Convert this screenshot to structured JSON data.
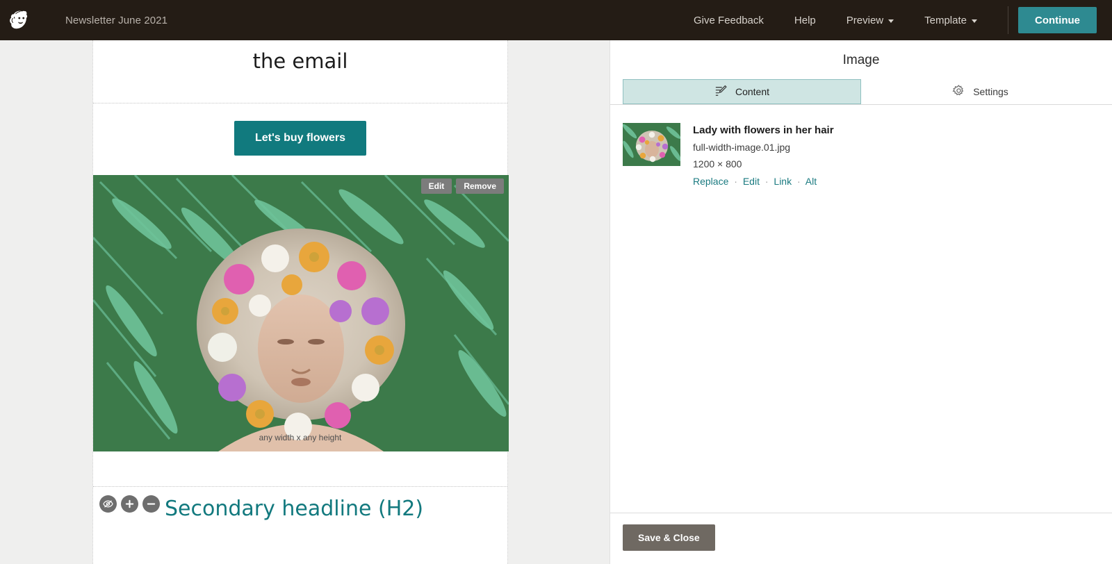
{
  "topbar": {
    "logo": "mailchimp-freddie-logo",
    "campaign_title": "Newsletter June 2021",
    "nav": [
      {
        "label": "Give Feedback",
        "caret": false
      },
      {
        "label": "Help",
        "caret": false
      },
      {
        "label": "Preview",
        "caret": true
      },
      {
        "label": "Template",
        "caret": true
      }
    ],
    "continue_label": "Continue",
    "bg_color": "#241c15",
    "accent_color": "#2e8a91"
  },
  "canvas": {
    "headline_partial": "the email",
    "cta_label": "Let's buy flowers",
    "cta_color": "#117a7e",
    "image_overlay": {
      "edit_label": "Edit",
      "remove_label": "Remove",
      "watermark": "any width x any height"
    },
    "h2_title": "Secondary headline (H2)",
    "h2_color": "#12797e",
    "tools": [
      {
        "name": "hide-eye-icon"
      },
      {
        "name": "plus-icon"
      },
      {
        "name": "minus-icon"
      }
    ]
  },
  "panel": {
    "title": "Image",
    "tabs": [
      {
        "label": "Content",
        "icon": "pencil-lines-icon",
        "active": true
      },
      {
        "label": "Settings",
        "icon": "gear-icon",
        "active": false
      }
    ],
    "media": {
      "name": "Lady with flowers in her hair",
      "filename": "full-width-image.01.jpg",
      "dimensions": "1200 × 800",
      "actions": [
        "Replace",
        "Edit",
        "Link",
        "Alt"
      ],
      "separator": "·"
    },
    "save_label": "Save & Close",
    "active_tab_bg": "#cfe5e3",
    "link_color": "#1a7a80"
  }
}
